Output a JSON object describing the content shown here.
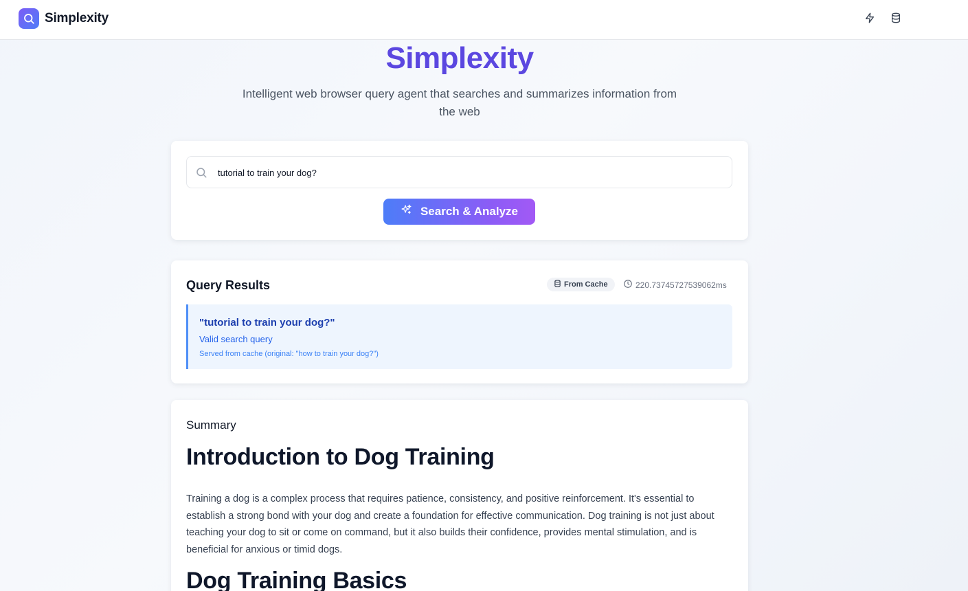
{
  "header": {
    "app_name": "Simplexity",
    "actions": [
      "lightning-icon",
      "database-icon"
    ]
  },
  "hero": {
    "title": "Simplexity",
    "subtitle": "Intelligent web browser query agent that searches and summarizes information from the web"
  },
  "search": {
    "value": "tutorial to train your dog?",
    "button_label": "Search & Analyze"
  },
  "results": {
    "title": "Query Results",
    "cache_badge": "From Cache",
    "timing": "220.73745727539062ms",
    "query_quoted": "\"tutorial to train your dog?\"",
    "validity": "Valid search query",
    "cache_note": "Served from cache (original: \"how to train your dog?\")"
  },
  "summary": {
    "label": "Summary",
    "heading1": "Introduction to Dog Training",
    "paragraph": "Training a dog is a complex process that requires patience, consistency, and positive reinforcement. It's essential to establish a strong bond with your dog and create a foundation for effective communication. Dog training is not just about teaching your dog to sit or come on command, but it also builds their confidence, provides mental stimulation, and is beneficial for anxious or timid dogs.",
    "heading2": "Dog Training Basics"
  },
  "colors": {
    "accent_start": "#4d7df8",
    "accent_end": "#a259f5",
    "title": "#5b47e0",
    "panel_bg": "#eef5fe",
    "panel_border": "#4f8ff7"
  }
}
